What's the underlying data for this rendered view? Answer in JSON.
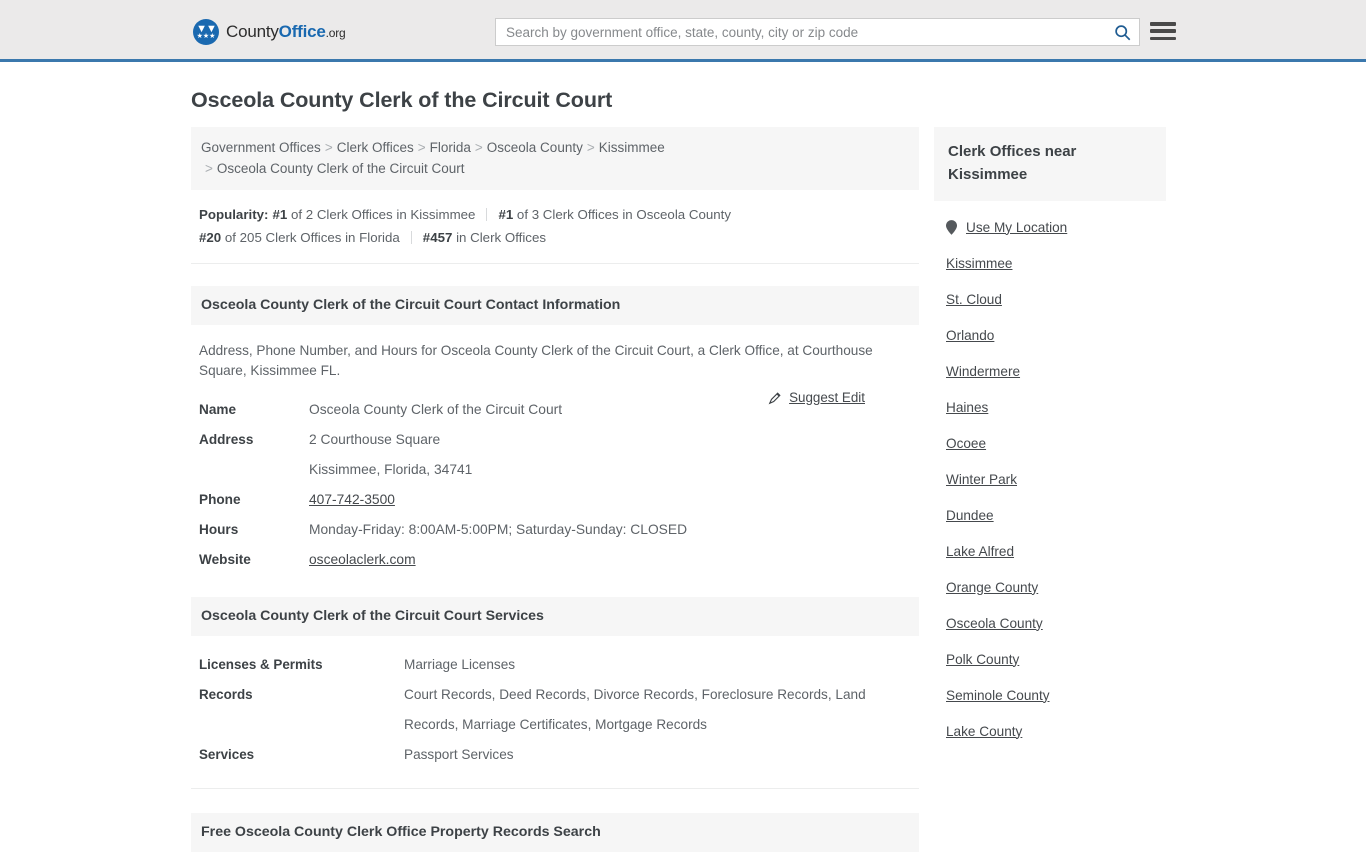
{
  "header": {
    "logo": {
      "text_part1": "County",
      "text_part2": "Office",
      "text_part3": ".org",
      "badge_icon": "eagle-seal-icon"
    },
    "search": {
      "placeholder": "Search by government office, state, county, city or zip code",
      "value": "",
      "icon": "search-icon"
    },
    "menu_icon": "hamburger-menu-icon",
    "accent_color": "#3b78ad",
    "background_color": "#ebeaea"
  },
  "page": {
    "title": "Osceola County Clerk of the Circuit Court"
  },
  "breadcrumb": {
    "separator": ">",
    "items": [
      "Government Offices",
      "Clerk Offices",
      "Florida",
      "Osceola County",
      "Kissimmee",
      "Osceola County Clerk of the Circuit Court"
    ]
  },
  "popularity": {
    "label": "Popularity:",
    "items": [
      {
        "rank": "#1",
        "rest": " of 2 Clerk Offices in Kissimmee"
      },
      {
        "rank": "#1",
        "rest": " of 3 Clerk Offices in Osceola County"
      },
      {
        "rank": "#20",
        "rest": " of 205 Clerk Offices in Florida"
      },
      {
        "rank": "#457",
        "rest": " in Clerk Offices"
      }
    ]
  },
  "contact_section": {
    "heading": "Osceola County Clerk of the Circuit Court Contact Information",
    "description": "Address, Phone Number, and Hours for Osceola County Clerk of the Circuit Court, a Clerk Office, at Courthouse Square, Kissimmee FL.",
    "suggest_edit": {
      "label": "Suggest Edit",
      "icon": "edit-pencil-icon"
    },
    "rows": [
      {
        "key": "Name",
        "value": "Osceola County Clerk of the Circuit Court",
        "link": false
      },
      {
        "key": "Address",
        "value": "2 Courthouse Square",
        "link": false
      },
      {
        "key": "",
        "value": "Kissimmee, Florida, 34741",
        "link": false
      },
      {
        "key": "Phone",
        "value": "407-742-3500",
        "link": true
      },
      {
        "key": "Hours",
        "value": "Monday-Friday: 8:00AM-5:00PM; Saturday-Sunday: CLOSED",
        "link": false
      },
      {
        "key": "Website",
        "value": "osceolaclerk.com",
        "link": true
      }
    ]
  },
  "services_section": {
    "heading": "Osceola County Clerk of the Circuit Court Services",
    "rows": [
      {
        "key": "Licenses & Permits",
        "value": "Marriage Licenses"
      },
      {
        "key": "Records",
        "value": "Court Records, Deed Records, Divorce Records, Foreclosure Records, Land Records, Marriage Certificates, Mortgage Records"
      },
      {
        "key": "Services",
        "value": "Passport Services"
      }
    ]
  },
  "next_section": {
    "heading": "Free Osceola County Clerk Office Property Records Search"
  },
  "sidebar": {
    "heading": "Clerk Offices near Kissimmee",
    "use_my_location": {
      "label": "Use My Location",
      "icon": "map-pin-icon"
    },
    "items": [
      "Kissimmee",
      "St. Cloud",
      "Orlando",
      "Windermere",
      "Haines",
      "Ocoee",
      "Winter Park",
      "Dundee",
      "Lake Alfred",
      "Orange County",
      "Osceola County",
      "Polk County",
      "Seminole County",
      "Lake County"
    ]
  }
}
